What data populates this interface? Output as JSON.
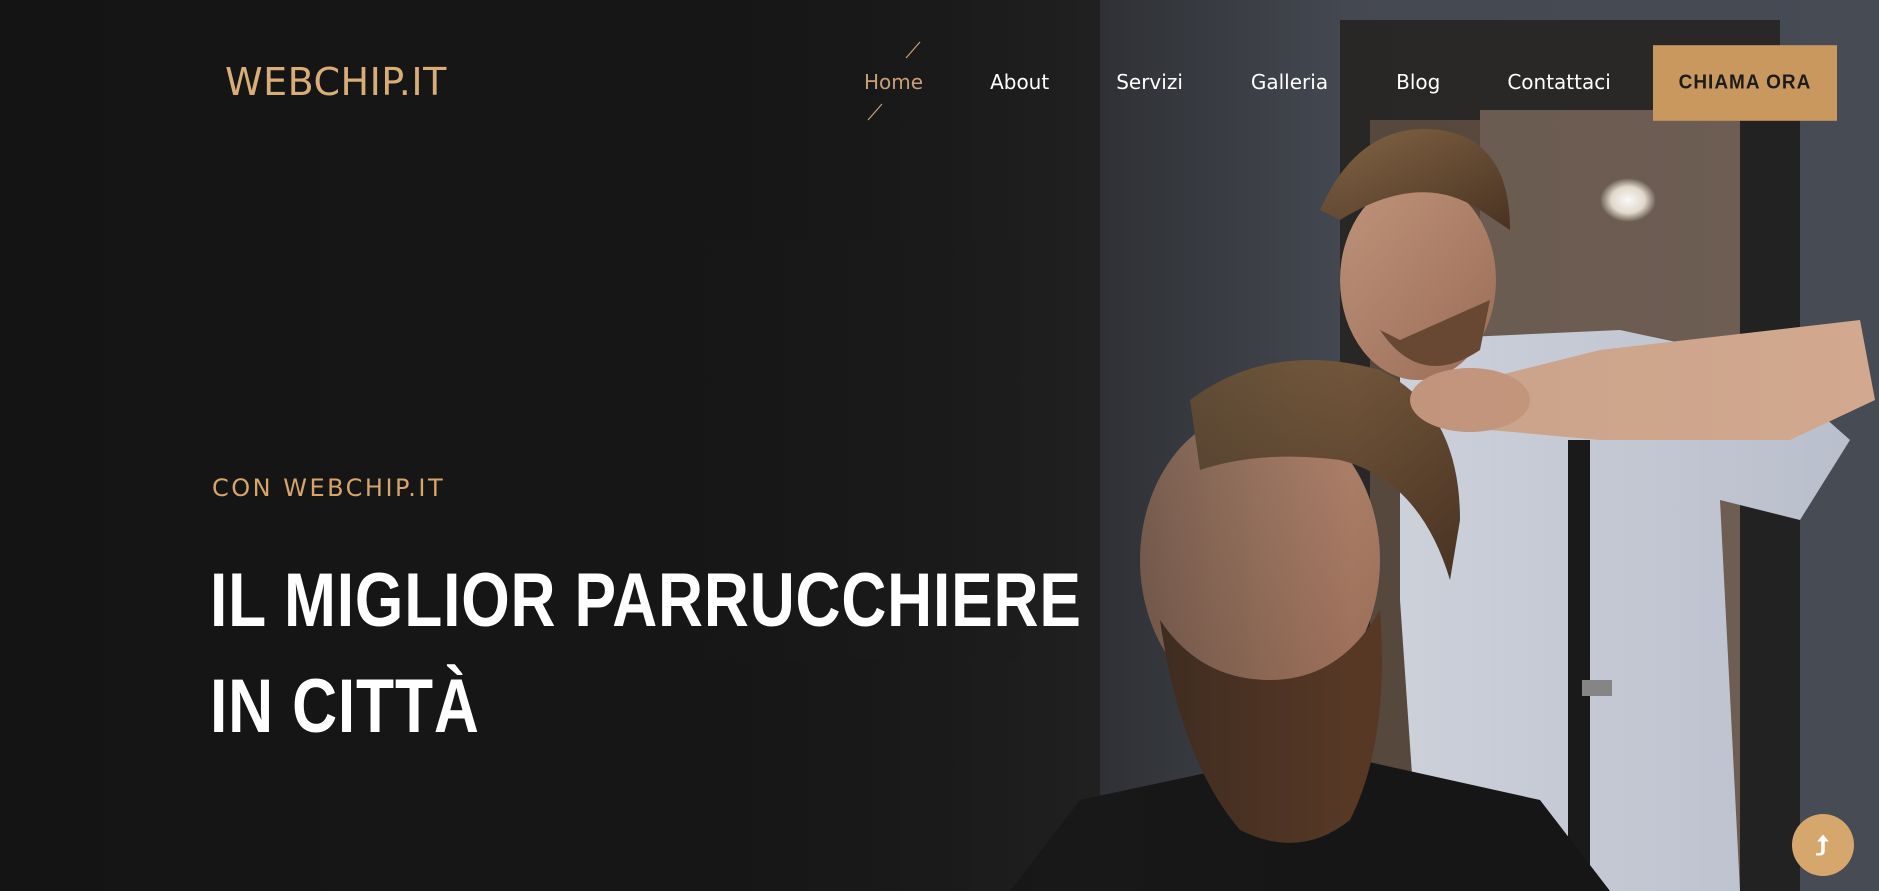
{
  "header": {
    "logo": "WEBCHIP.IT",
    "nav": [
      {
        "label": "Home",
        "active": true
      },
      {
        "label": "About",
        "active": false
      },
      {
        "label": "Servizi",
        "active": false
      },
      {
        "label": "Galleria",
        "active": false
      },
      {
        "label": "Blog",
        "active": false
      },
      {
        "label": "Contattaci",
        "active": false
      }
    ],
    "cta_label": "CHIAMA ORA"
  },
  "hero": {
    "eyebrow": "CON WEBCHIP.IT",
    "headline_line1": "IL MIGLIOR PARRUCCHIERE",
    "headline_line2": "IN CITTÀ"
  },
  "scroll_top": {
    "icon": "arrow-up-icon"
  },
  "colors": {
    "accent": "#c9985f",
    "nav_active": "#c8a075",
    "text_light": "#ffffff",
    "background": "#1b1b1b"
  }
}
